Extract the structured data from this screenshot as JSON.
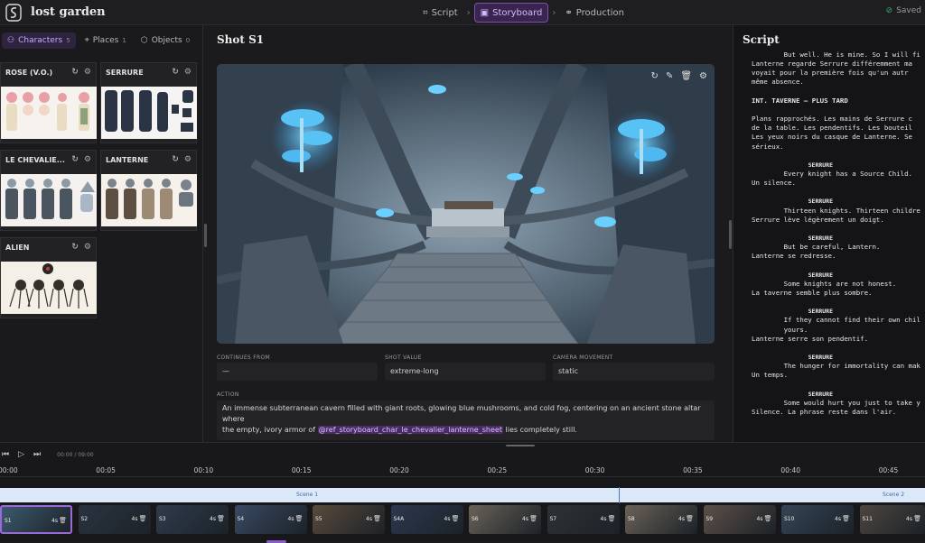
{
  "header": {
    "project_name": "lost garden",
    "steps": [
      {
        "label": "Script",
        "icon": "script-icon"
      },
      {
        "label": "Storyboard",
        "icon": "storyboard-icon"
      },
      {
        "label": "Production",
        "icon": "production-icon"
      }
    ],
    "active_step": "Storyboard",
    "status": "Saved"
  },
  "left_panel": {
    "tabs": [
      {
        "label": "Characters",
        "count": "5"
      },
      {
        "label": "Places",
        "count": "1"
      },
      {
        "label": "Objects",
        "count": "0"
      }
    ],
    "cards": [
      {
        "title": "ROSE (V.O.)"
      },
      {
        "title": "SERRURE"
      },
      {
        "title": "LE CHEVALIE..."
      },
      {
        "title": "LANTERNE"
      },
      {
        "title": "ALIEN"
      }
    ]
  },
  "shot": {
    "title": "Shot S1",
    "continues_from_label": "CONTINUES FROM",
    "continues_from_value": "—",
    "shot_value_label": "SHOT VALUE",
    "shot_value": "extreme-long",
    "camera_label": "CAMERA MOVEMENT",
    "camera_value": "static",
    "action_label": "ACTION",
    "action_text_1": "An immense subterranean cavern filled with giant roots, glowing blue mushrooms, and cold fog, centering on an ancient stone altar where",
    "action_text_2a": "the empty, ivory armor of ",
    "action_mention": "@ref_storyboard_char_le_chevalier_lanterne_sheet",
    "action_text_2b": " lies completely still."
  },
  "script_panel": {
    "title": "Script",
    "lines": [
      "        But well. He is mine. So I will fi",
      "Lanterne regarde Serrure différemment ma",
      "voyait pour la première fois qu'un autr",
      "même absence.",
      "",
      "INT. TAVERNE — PLUS TARD",
      "",
      "Plans rapprochés. Les mains de Serrure c",
      "de la table. Les pendentifs. Les bouteil",
      "Les yeux noirs du casque de Lanterne. Se",
      "sérieux.",
      "",
      "                SERRURE",
      "        Every knight has a Source Child.",
      "Un silence.",
      "",
      "                SERRURE",
      "        Thirteen knights. Thirteen childre",
      "Serrure lève légèrement un doigt.",
      "",
      "                SERRURE",
      "        But be careful, Lantern.",
      "Lanterne se redresse.",
      "",
      "                SERRURE",
      "        Some knights are not honest.",
      "La taverne semble plus sombre.",
      "",
      "                SERRURE",
      "        If they cannot find their own chil",
      "        yours.",
      "Lanterne serre son pendentif.",
      "",
      "                SERRURE",
      "        The hunger for immortality can mak",
      "Un temps.",
      "",
      "                SERRURE",
      "        Some would hurt you just to take y",
      "Silence. La phrase reste dans l'air."
    ]
  },
  "timeline": {
    "current_time": "00:00",
    "total_time": "09:00",
    "ticks": [
      "00:00",
      "00:05",
      "00:10",
      "00:15",
      "00:20",
      "00:25",
      "00:30",
      "00:35",
      "00:40",
      "00:45"
    ],
    "scenes": [
      "Scene 1",
      "Scene 2"
    ],
    "shots": [
      {
        "label": "S1",
        "duration": "4s",
        "color": "#3b5a6e"
      },
      {
        "label": "S2",
        "duration": "4s",
        "color": "#2a3340"
      },
      {
        "label": "S3",
        "duration": "4s",
        "color": "#2f3c4d"
      },
      {
        "label": "S4",
        "duration": "4s",
        "color": "#394a63"
      },
      {
        "label": "S5",
        "duration": "4s",
        "color": "#5a4a3c"
      },
      {
        "label": "S4A",
        "duration": "4s",
        "color": "#2c3850"
      },
      {
        "label": "S6",
        "duration": "4s",
        "color": "#6a6258"
      },
      {
        "label": "S7",
        "duration": "4s",
        "color": "#2d3234"
      },
      {
        "label": "S8",
        "duration": "4s",
        "color": "#6b6257"
      },
      {
        "label": "S9",
        "duration": "4s",
        "color": "#5c5048"
      },
      {
        "label": "S10",
        "duration": "4s",
        "color": "#354556"
      },
      {
        "label": "S11",
        "duration": "4s",
        "color": "#4e4540"
      }
    ]
  },
  "colors": {
    "accent": "#9a6ad8",
    "saved": "#3aa875",
    "mushroom": "#4fb8f0"
  }
}
